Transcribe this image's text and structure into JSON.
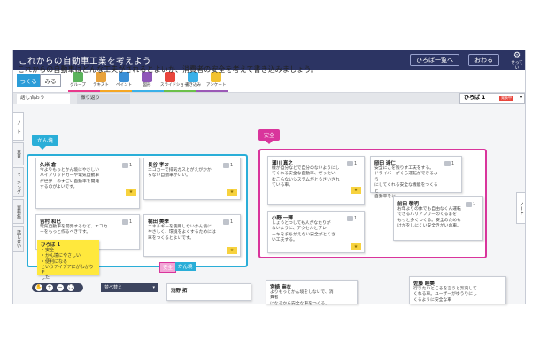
{
  "header": {
    "title": "これからの自動車工業を考えよう",
    "buttons": [
      "ひろば一覧へ",
      "おわる"
    ],
    "gear_label": "せってい"
  },
  "toolbar": {
    "modes": [
      "つくる",
      "みる"
    ],
    "tools": [
      {
        "label": "グループ",
        "icon": "group-icon",
        "color": "#5bb35b"
      },
      {
        "label": "テキスト",
        "icon": "text-icon",
        "color": "#e8a23a"
      },
      {
        "label": "ペイント",
        "icon": "paint-icon",
        "color": "#3a8fd6"
      },
      {
        "label": "図形",
        "icon": "shape-icon",
        "color": "#8e56b8"
      },
      {
        "label": "スライドショー",
        "icon": "slideshow-icon",
        "color": "#e8453c"
      },
      {
        "label": "書き込み",
        "icon": "write-icon",
        "color": "#3ab0e8"
      },
      {
        "label": "アンケート",
        "icon": "survey-icon",
        "color": "#f2c230"
      }
    ]
  },
  "tabs": [
    "話し合おう",
    "振り返り"
  ],
  "hiroba": {
    "label": "ひろば 1",
    "tag": "発表中"
  },
  "side_tabs": [
    "ノート",
    "意見",
    "マーキング",
    "資料集",
    "話し合い"
  ],
  "question": "これからの自動車はどんな工夫がされるとよいか、消費者の安全を考えて書き込みましょう。",
  "groups": [
    {
      "label": "かん境",
      "color": "#2aaed8"
    },
    {
      "label": "安全",
      "color": "#d9359c"
    }
  ],
  "cards": [
    {
      "name": "久米 倉",
      "body": [
        "今よりもっとかん境にやさしい",
        "ハイブリッドカーや電気自動車",
        "が世界一のすごい自動車を開発",
        "するのがよいです。"
      ],
      "count": "1"
    },
    {
      "name": "長谷 孝お",
      "body": [
        "エコカーで排気ガスとがえがかか",
        "らない自動車がいい。"
      ],
      "count": "1"
    },
    {
      "name": "吉村 和巳",
      "body": [
        "電気自動車を開発するなど、エコカ",
        "ーをもっと作るべきです。"
      ],
      "count": "1"
    },
    {
      "name": "梶田 美季",
      "body": [
        "エネルギーを使用しないかん境に",
        "やさしく、環境をよくするためには",
        "車をつくるとよいです。"
      ],
      "count": "1"
    },
    {
      "name": "瀬川 真之",
      "body": [
        "機が自分などで自分のないようにし",
        "てくれる安全な自動車、ぜったい",
        "むこらないシステムがとうさいされ",
        "ている車。"
      ],
      "count": "1"
    },
    {
      "name": "岡田 達仁",
      "body": [
        "安全にこを残りす工夫をする。",
        "ドライバーがくら運転ができるよう",
        "にしてくれる安全な機能をつくると",
        "自動車をに。"
      ],
      "count": "1"
    },
    {
      "name": "小野 一輝",
      "body": [
        "しょうとつしても人がなたりが",
        "ないように、アクセルとブレ",
        "ーキをまちがえない安全がとくさ",
        "い工夫する。"
      ],
      "count": "1"
    },
    {
      "name": "前田 敬明",
      "body": [
        "お年よりの体でも自由なくん運転",
        "できるバリアフリーのくるまを",
        "もっと多くつくる。安全のためも",
        "けがをしにくい安全きがいの車。"
      ],
      "count": "1"
    },
    {
      "name": "浅野 拓",
      "body": [],
      "count": ""
    },
    {
      "name": "宮崎 麻衣",
      "body": [
        "よりもっとかん境をしないで、消費者",
        "になるから安全な車をつくる。"
      ],
      "count": ""
    },
    {
      "name": "佐藤 睦美",
      "body": [
        "行きたいところを言うと案内して",
        "くれる車。ユーザーがゆうりにし",
        "くるように安全な車"
      ],
      "count": ""
    }
  ],
  "sticky": {
    "title": "ひろば 1",
    "lines": [
      "・安全",
      "・かん境にやさしい",
      "・便利になる",
      "というアイデアにがわかりま",
      "した"
    ]
  },
  "small_tags": [
    "安全",
    "かん境"
  ],
  "bottom": {
    "sort_label": "並べ替え"
  },
  "note_tab": "ノート"
}
